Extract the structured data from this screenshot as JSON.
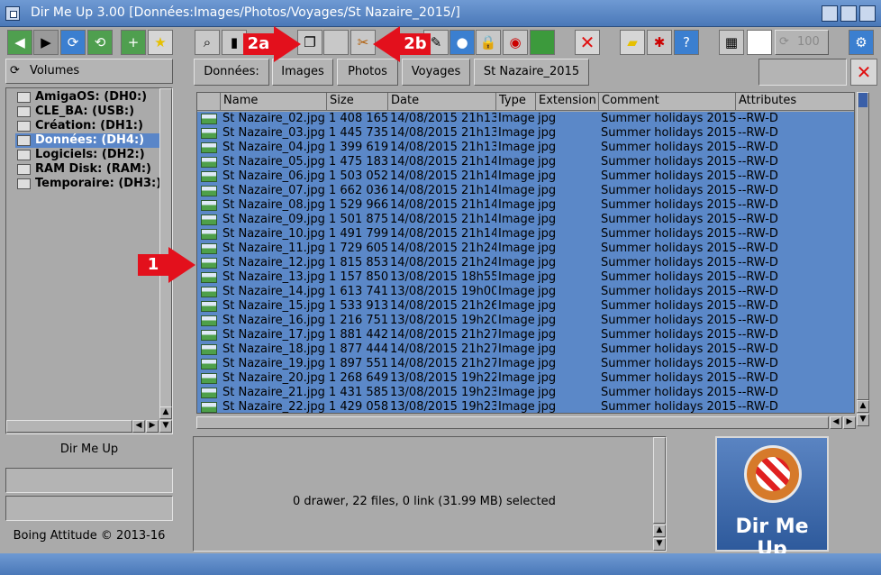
{
  "window": {
    "title": "Dir Me Up 3.00 [Données:Images/Photos/Voyages/St Nazaire_2015/]"
  },
  "toolbar": {
    "icons": [
      "back-icon",
      "forward-icon",
      "refresh-icon",
      "reload-icon",
      "upload-icon",
      "star-icon",
      "magnify-icon",
      "film-icon",
      "copy-icon",
      "blank-icon",
      "scissors-icon",
      "edit-icon",
      "comment-icon",
      "lock-icon",
      "archive-icon",
      "book-icon",
      "delete-icon",
      "folder-icon",
      "bug-icon",
      "info-icon",
      "table-icon",
      "grid-icon",
      "recycle-icon",
      "settings-icon"
    ],
    "zoom_value": "100"
  },
  "volumes": {
    "header": "Volumes",
    "items": [
      {
        "label": "AmigaOS: (DH0:)",
        "selected": false
      },
      {
        "label": "CLE_BA: (USB:)",
        "selected": false
      },
      {
        "label": "Création: (DH1:)",
        "selected": false
      },
      {
        "label": "Données: (DH4:)",
        "selected": true
      },
      {
        "label": "Logiciels: (DH2:)",
        "selected": false
      },
      {
        "label": "RAM Disk: (RAM:)",
        "selected": false
      },
      {
        "label": "Temporaire: (DH3:)",
        "selected": false
      }
    ]
  },
  "left_panel": {
    "app_name": "Dir Me Up",
    "copyright": "Boing Attitude © 2013-16"
  },
  "breadcrumb": [
    "Données:",
    "Images",
    "Photos",
    "Voyages",
    "St Nazaire_2015"
  ],
  "columns": [
    "Name",
    "Size",
    "Date",
    "Type",
    "Extension",
    "Comment",
    "Attributes"
  ],
  "files": [
    [
      "St Nazaire_02.jpg",
      "1 408 165",
      "14/08/2015 21h13",
      "Image",
      "jpg",
      "Summer holidays 2015",
      "--RW-D"
    ],
    [
      "St Nazaire_03.jpg",
      "1 445 735",
      "14/08/2015 21h13",
      "Image",
      "jpg",
      "Summer holidays 2015",
      "--RW-D"
    ],
    [
      "St Nazaire_04.jpg",
      "1 399 619",
      "14/08/2015 21h13",
      "Image",
      "jpg",
      "Summer holidays 2015",
      "--RW-D"
    ],
    [
      "St Nazaire_05.jpg",
      "1 475 183",
      "14/08/2015 21h14",
      "Image",
      "jpg",
      "Summer holidays 2015",
      "--RW-D"
    ],
    [
      "St Nazaire_06.jpg",
      "1 503 052",
      "14/08/2015 21h14",
      "Image",
      "jpg",
      "Summer holidays 2015",
      "--RW-D"
    ],
    [
      "St Nazaire_07.jpg",
      "1 662 036",
      "14/08/2015 21h14",
      "Image",
      "jpg",
      "Summer holidays 2015",
      "--RW-D"
    ],
    [
      "St Nazaire_08.jpg",
      "1 529 966",
      "14/08/2015 21h14",
      "Image",
      "jpg",
      "Summer holidays 2015",
      "--RW-D"
    ],
    [
      "St Nazaire_09.jpg",
      "1 501 875",
      "14/08/2015 21h14",
      "Image",
      "jpg",
      "Summer holidays 2015",
      "--RW-D"
    ],
    [
      "St Nazaire_10.jpg",
      "1 491 799",
      "14/08/2015 21h14",
      "Image",
      "jpg",
      "Summer holidays 2015",
      "--RW-D"
    ],
    [
      "St Nazaire_11.jpg",
      "1 729 605",
      "14/08/2015 21h24",
      "Image",
      "jpg",
      "Summer holidays 2015",
      "--RW-D"
    ],
    [
      "St Nazaire_12.jpg",
      "1 815 853",
      "14/08/2015 21h24",
      "Image",
      "jpg",
      "Summer holidays 2015",
      "--RW-D"
    ],
    [
      "St Nazaire_13.jpg",
      "1 157 850",
      "13/08/2015 18h55",
      "Image",
      "jpg",
      "Summer holidays 2015",
      "--RW-D"
    ],
    [
      "St Nazaire_14.jpg",
      "1 613 741",
      "13/08/2015 19h00",
      "Image",
      "jpg",
      "Summer holidays 2015",
      "--RW-D"
    ],
    [
      "St Nazaire_15.jpg",
      "1 533 913",
      "14/08/2015 21h26",
      "Image",
      "jpg",
      "Summer holidays 2015",
      "--RW-D"
    ],
    [
      "St Nazaire_16.jpg",
      "1 216 751",
      "13/08/2015 19h20",
      "Image",
      "jpg",
      "Summer holidays 2015",
      "--RW-D"
    ],
    [
      "St Nazaire_17.jpg",
      "1 881 442",
      "14/08/2015 21h27",
      "Image",
      "jpg",
      "Summer holidays 2015",
      "--RW-D"
    ],
    [
      "St Nazaire_18.jpg",
      "1 877 444",
      "14/08/2015 21h27",
      "Image",
      "jpg",
      "Summer holidays 2015",
      "--RW-D"
    ],
    [
      "St Nazaire_19.jpg",
      "1 897 551",
      "14/08/2015 21h27",
      "Image",
      "jpg",
      "Summer holidays 2015",
      "--RW-D"
    ],
    [
      "St Nazaire_20.jpg",
      "1 268 649",
      "13/08/2015 19h22",
      "Image",
      "jpg",
      "Summer holidays 2015",
      "--RW-D"
    ],
    [
      "St Nazaire_21.jpg",
      "1 431 585",
      "13/08/2015 19h23",
      "Image",
      "jpg",
      "Summer holidays 2015",
      "--RW-D"
    ],
    [
      "St Nazaire_22.jpg",
      "1 429 058",
      "13/08/2015 19h23",
      "Image",
      "jpg",
      "Summer holidays 2015",
      "--RW-D"
    ]
  ],
  "status": {
    "text": "0 drawer, 22 files, 0 link (31.99 MB) selected"
  },
  "annotations": [
    "1",
    "2a",
    "2b"
  ],
  "logo": {
    "text": "Dir Me Up"
  },
  "colors": {
    "selection": "#5b88c8",
    "titlebar": "#5a86c6",
    "accent_red": "#e3101c"
  }
}
